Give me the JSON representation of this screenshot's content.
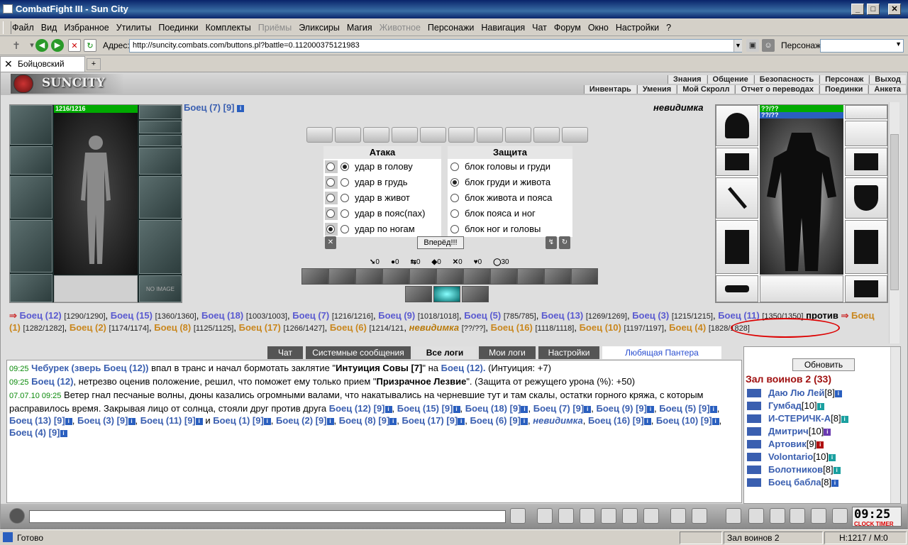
{
  "window": {
    "title": "CombatFight III - Sun City"
  },
  "menu": [
    "Файл",
    "Вид",
    "Избранное",
    "Утилиты",
    "Поединки",
    "Комплекты",
    "Приёмы",
    "Эликсиры",
    "Магия",
    "Животное",
    "Персонажи",
    "Навигация",
    "Чат",
    "Форум",
    "Окно",
    "Настройки",
    "?"
  ],
  "menu_disabled": [
    "Приёмы",
    "Животное"
  ],
  "address": {
    "label": "Адрес:",
    "url": "http://suncity.combats.com/buttons.pl?battle=0.112000375121983",
    "char_label": "Персонаж:"
  },
  "tab": {
    "title": "Бойцовский клуб"
  },
  "game": {
    "logo": "SUNCITY",
    "nav_top": [
      "Знания",
      "Общение",
      "Безопасность",
      "Персонаж",
      "Выход"
    ],
    "nav_bottom": [
      "Инвентарь",
      "Умения",
      "Мой Скролл",
      "Отчет о переводах",
      "Поединки",
      "Анкета"
    ],
    "left_fighter": {
      "name": "Боец (7) [9]",
      "hp": "1216/1216"
    },
    "right_fighter": {
      "name": "невидимка",
      "hp": "??/??",
      "mp": "??/??"
    },
    "attack": {
      "title": "Атака",
      "options": [
        "удар в голову",
        "удар в грудь",
        "удар в живот",
        "удар в пояс(пах)",
        "удар по ногам"
      ],
      "selected": 0
    },
    "defend": {
      "title": "Защита",
      "options": [
        "блок головы и груди",
        "блок груди и живота",
        "блок живота и пояса",
        "блок пояса и ног",
        "блок ног и головы"
      ],
      "selected": 1
    },
    "forward_button": "Вперёд!!!",
    "stats": [
      "0",
      "0",
      "0",
      "0",
      "0",
      "0",
      "30"
    ],
    "no_image": "NO IMAGE",
    "vs": "против",
    "team1": [
      {
        "n": "Боец (12)",
        "hp": "[1290/1290]"
      },
      {
        "n": "Боец (15)",
        "hp": "[1360/1360]"
      },
      {
        "n": "Боец (18)",
        "hp": "[1003/1003]"
      },
      {
        "n": "Боец (7)",
        "hp": "[1216/1216]"
      },
      {
        "n": "Боец (9)",
        "hp": "[1018/1018]"
      },
      {
        "n": "Боец (5)",
        "hp": "[785/785]"
      },
      {
        "n": "Боец (13)",
        "hp": "[1269/1269]"
      },
      {
        "n": "Боец (3)",
        "hp": "[1215/1215]"
      },
      {
        "n": "Боец (11)",
        "hp": "[1350/1350]"
      }
    ],
    "team2": [
      {
        "n": "Боец (1)",
        "hp": "[1282/1282]"
      },
      {
        "n": "Боец (2)",
        "hp": "[1174/1174]"
      },
      {
        "n": "Боец (8)",
        "hp": "[1125/1125]"
      },
      {
        "n": "Боец (17)",
        "hp": "[1266/1427]"
      },
      {
        "n": "Боец (6)",
        "hp": "[1214/121"
      }
    ],
    "team2_invis": {
      "n": "невидимка",
      "hp": "[??/??]"
    },
    "team2_cont": [
      {
        "n": "Боец",
        "hp": ""
      },
      {
        "n": "(16)",
        "hp": "[1118/1118]"
      },
      {
        "n": "Боец (10)",
        "hp": "[1197/1197]"
      },
      {
        "n": "Боец (4)",
        "hp": "[1828/1828]"
      }
    ],
    "log_tabs": [
      "Чат",
      "Системные сообщения",
      "Все логи",
      "Мои логи",
      "Настройки",
      "Любящая Пантера"
    ],
    "log_tab_active": "Все логи",
    "log": {
      "l1_time": "09:25",
      "l1_a": "Чебурек (зверь Боец (12))",
      "l1_b": " впал в транс и начал бормотать заклятие \"",
      "l1_c": "Интуиция Совы [7]",
      "l1_d": "\" на ",
      "l1_e": "Боец (12).",
      "l1_f": " (Интуиция: +7)",
      "l2_time": "09:25",
      "l2_a": "Боец (12)",
      "l2_b": ", нетрезво оценив положение, решил, что поможет ему только прием \"",
      "l2_c": "Призрачное Лезвие",
      "l2_d": "\". (Защита от режущего урона (%): +50)",
      "l3_time": "07.07.10 09:25",
      "l3_text": " Ветер гнал песчаные волны, дюны казались огромными валами, что накатывались на черневшие тут и там скалы, остатки горного кряжа, с которым расправилось время. Закрывая лицо от солнца, стояли друг против друга ",
      "l3_team1": [
        "Боец (12) [9]",
        "Боец (15) [9]",
        "Боец (18) [9]",
        "Боец (7) [9]",
        "Боец (9) [9]",
        "Боец (5) [9]",
        "Боец (13) [9]",
        "Боец (3) [9]",
        "Боец (11) [9]"
      ],
      "l3_and": " и ",
      "l3_team2": [
        "Боец (1) [9]",
        "Боец (2) [9]",
        "Боец (8) [9]",
        "Боец (17) [9]",
        "Боец (6) [9]"
      ],
      "l3_invis": "невидимка",
      "l3_team2b": [
        "Боец (16) [9]",
        "Боец (10) [9]",
        "Боец (4) [9]"
      ]
    },
    "right_panel": {
      "refresh": "Обновить",
      "hall": "Зал воинов 2 (33)",
      "players": [
        {
          "n": "Даю Лю Лей",
          "lvl": "[8]"
        },
        {
          "n": "Гумбад",
          "lvl": "[10]"
        },
        {
          "n": "И-СТЕРИЧК-А",
          "lvl": "[8]"
        },
        {
          "n": "Дмитрич",
          "lvl": "[10]"
        },
        {
          "n": "Артовик",
          "lvl": "[9]"
        },
        {
          "n": "Volontario",
          "lvl": "[10]"
        },
        {
          "n": "Болотников",
          "lvl": "[8]"
        },
        {
          "n": "Боец бабла",
          "lvl": "[8]"
        }
      ]
    },
    "clock": {
      "time": "09:25",
      "label": "CLOCK TIMER"
    }
  },
  "status": {
    "text": "Готово",
    "room": "Зал воинов 2",
    "coords": "H:1217 / M:0"
  }
}
